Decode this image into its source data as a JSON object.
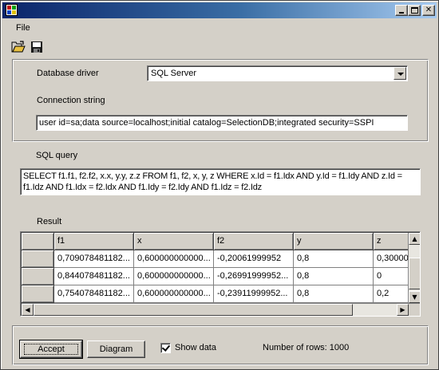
{
  "menu": {
    "file": "File"
  },
  "labels": {
    "database_driver": "Database driver",
    "connection_string": "Connection string",
    "sql_query": "SQL query",
    "result": "Result"
  },
  "driver": {
    "selected": "SQL Server"
  },
  "connection": {
    "value": "user id=sa;data source=localhost;initial catalog=SelectionDB;integrated security=SSPI"
  },
  "sql": {
    "value": "SELECT f1.f1, f2.f2, x.x, y.y, z.z FROM f1, f2, x, y, z WHERE x.Id = f1.Idx AND y.Id = f1.Idy AND z.Id = f1.Idz AND f1.Idx = f2.Idx AND f1.Idy = f2.Idy AND f1.Idz = f2.Idz"
  },
  "grid": {
    "columns": [
      "f1",
      "x",
      "f2",
      "y",
      "z"
    ],
    "rows": [
      [
        "0,709078481182...",
        "0,600000000000...",
        "-0,20061999952",
        "0,8",
        "0,30000"
      ],
      [
        "0,844078481182...",
        "0,600000000000...",
        "-0,26991999952...",
        "0,8",
        "0"
      ],
      [
        "0,754078481182...",
        "0,600000000000...",
        "-0,23911999952...",
        "0,8",
        "0,2"
      ]
    ]
  },
  "actions": {
    "accept": "Accept",
    "diagram": "Diagram",
    "show_data": "Show data",
    "show_data_checked": true,
    "row_count": "Number of rows: 1000"
  }
}
